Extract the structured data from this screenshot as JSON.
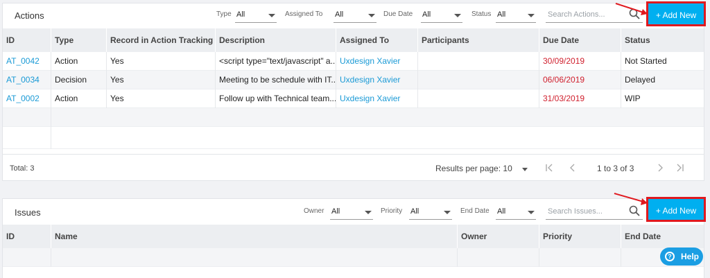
{
  "actions": {
    "title": "Actions",
    "filters": [
      {
        "label": "Type",
        "value": "All"
      },
      {
        "label": "Assigned To",
        "value": "All"
      },
      {
        "label": "Due Date",
        "value": "All"
      },
      {
        "label": "Status",
        "value": "All"
      }
    ],
    "search_placeholder": "Search Actions...",
    "add_label": "+ Add New",
    "columns": [
      "ID",
      "Type",
      "Record in Action Tracking",
      "Description",
      "Assigned To",
      "Participants",
      "Due Date",
      "Status"
    ],
    "rows": [
      {
        "id": "AT_0042",
        "type": "Action",
        "record": "Yes",
        "description": "<script type=\"text/javascript\" a...",
        "assigned": "Uxdesign Xavier",
        "participants": "",
        "due": "30/09/2019",
        "status": "Not Started"
      },
      {
        "id": "AT_0034",
        "type": "Decision",
        "record": "Yes",
        "description": "Meeting to be schedule with IT...",
        "assigned": "Uxdesign Xavier",
        "participants": "",
        "due": "06/06/2019",
        "status": "Delayed"
      },
      {
        "id": "AT_0002",
        "type": "Action",
        "record": "Yes",
        "description": "Follow up with Technical team...",
        "assigned": "Uxdesign Xavier",
        "participants": "",
        "due": "31/03/2019",
        "status": "WIP"
      }
    ],
    "footer": {
      "total": "Total: 3",
      "results_per_page": "Results per page: 10",
      "range": "1 to 3 of 3"
    }
  },
  "issues": {
    "title": "Issues",
    "filters": [
      {
        "label": "Owner",
        "value": "All"
      },
      {
        "label": "Priority",
        "value": "All"
      },
      {
        "label": "End Date",
        "value": "All"
      }
    ],
    "search_placeholder": "Search Issues...",
    "add_label": "+ Add New",
    "columns": [
      "ID",
      "Name",
      "Owner",
      "Priority",
      "End Date"
    ]
  },
  "help": {
    "label": "Help",
    "icon_glyph": "?"
  },
  "colors": {
    "accent": "#00aff0",
    "highlight": "#e0191f",
    "link": "#1a9ad6",
    "due": "#d0202e"
  }
}
